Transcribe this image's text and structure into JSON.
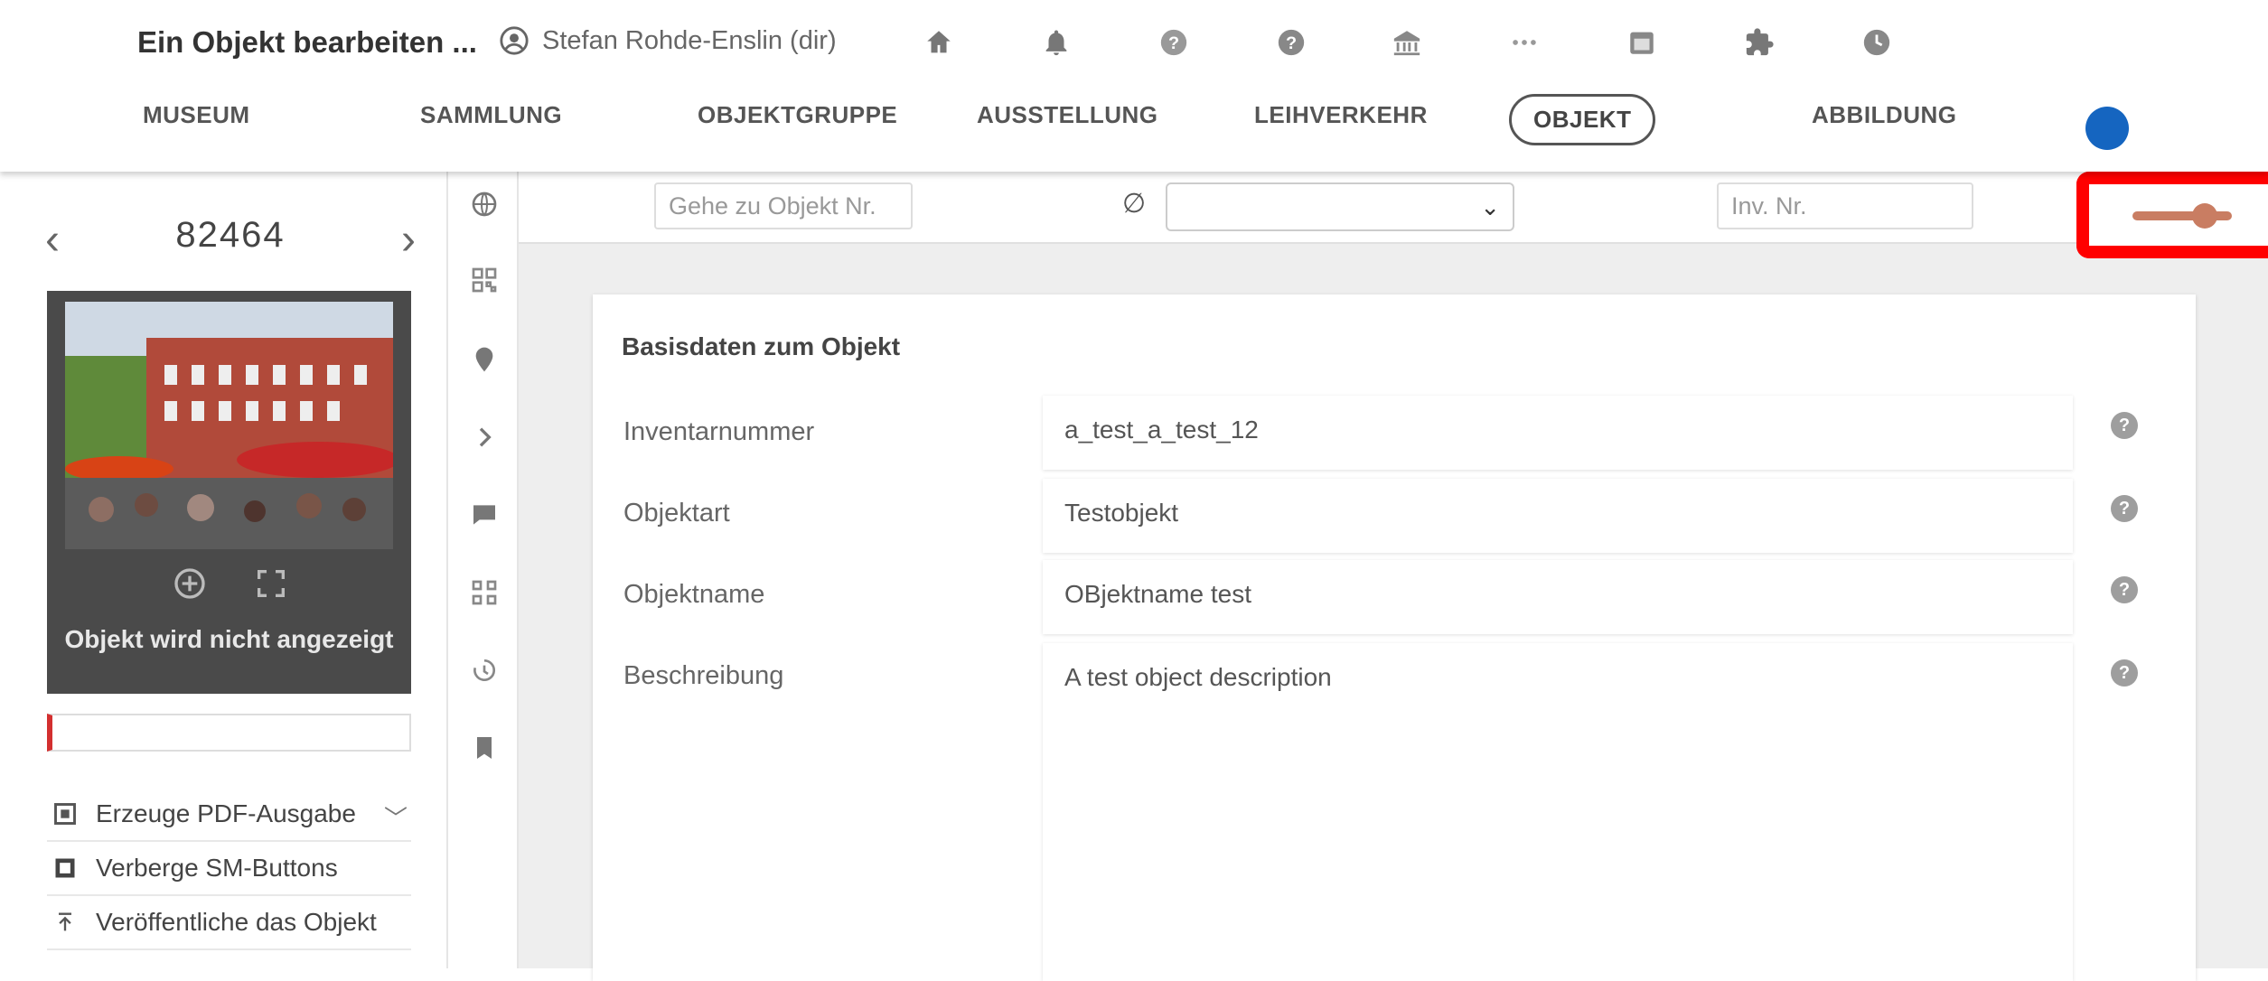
{
  "header": {
    "title": "Ein Objekt bearbeiten ...",
    "user_label": "Stefan Rohde-Enslin (dir)",
    "icons": [
      "home-icon",
      "bell-icon",
      "help-icon",
      "help-circle-icon",
      "institution-icon",
      "more-icon",
      "calendar-icon",
      "puzzle-icon",
      "clock-icon"
    ]
  },
  "tabs": [
    {
      "label": "MUSEUM"
    },
    {
      "label": "SAMMLUNG"
    },
    {
      "label": "OBJEKTGRUPPE"
    },
    {
      "label": "AUSSTELLUNG"
    },
    {
      "label": "LEIHVERKEHR"
    },
    {
      "label": "OBJEKT",
      "active": true
    },
    {
      "label": "ABBILDUNG"
    }
  ],
  "left": {
    "object_number": "82464",
    "image_caption": "Objekt wird nicht angezeigt",
    "menu": [
      {
        "label": "Erzeuge PDF-Ausgabe",
        "icon": "pdf-icon",
        "has_chevron": true
      },
      {
        "label": "Verberge SM-Buttons",
        "icon": "hide-buttons-icon"
      },
      {
        "label": "Veröffentliche das Objekt",
        "icon": "publish-icon"
      }
    ]
  },
  "toolbar": {
    "goto_placeholder": "Gehe zu Objekt Nr.",
    "empty_symbol": "∅",
    "select_value": "",
    "inv_placeholder": "Inv. Nr."
  },
  "form": {
    "section_title": "Basisdaten zum Objekt",
    "fields": [
      {
        "label": "Inventarnummer",
        "value": "a_test_a_test_12"
      },
      {
        "label": "Objektart",
        "value": "Testobjekt"
      },
      {
        "label": "Objektname",
        "value": "OBjektname test"
      },
      {
        "label": "Beschreibung",
        "value": "A test object description"
      }
    ]
  },
  "colors": {
    "accent": "#1565c0",
    "slider": "#c97d62",
    "highlight": "#ff0000",
    "error": "#d32f2f"
  }
}
